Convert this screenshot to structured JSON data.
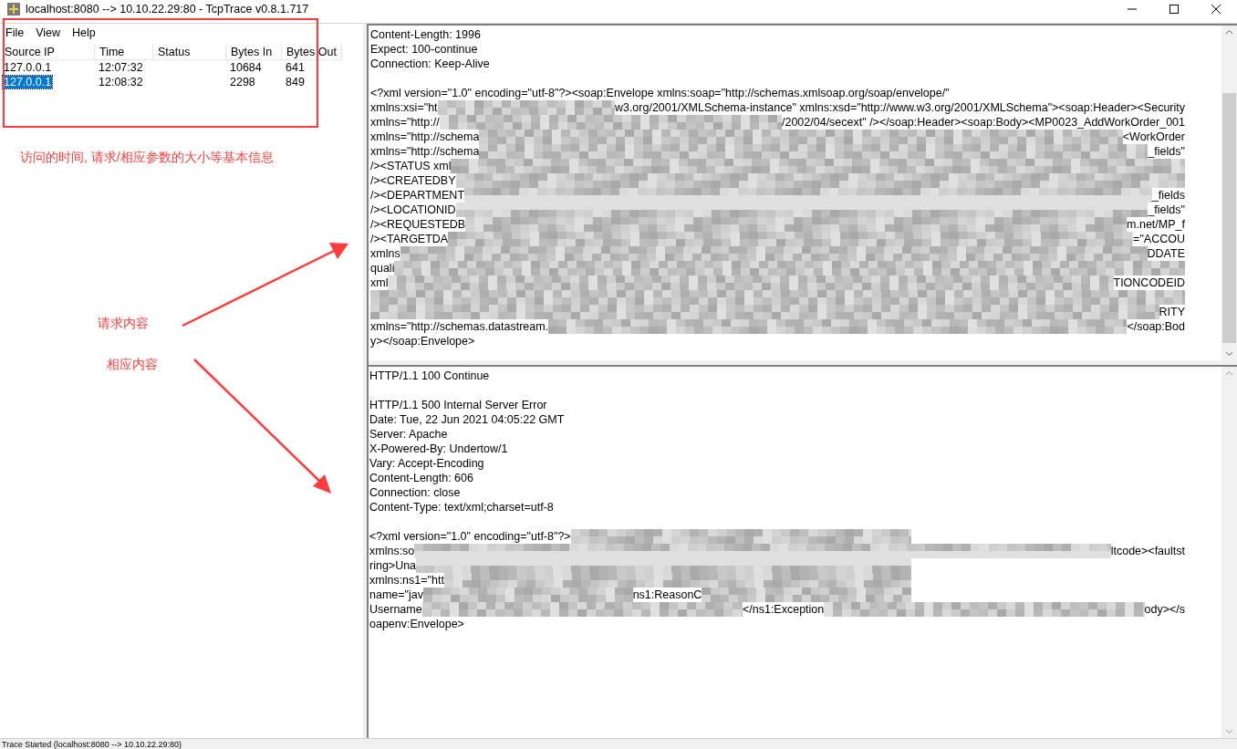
{
  "window": {
    "title": "localhost:8080 --> 10.10.22.29:80 - TcpTrace v0.8.1.717"
  },
  "menu": [
    {
      "label": "File"
    },
    {
      "label": "View"
    },
    {
      "label": "Help"
    }
  ],
  "table": {
    "columns": [
      "Source IP",
      "Time",
      "Status",
      "Bytes In",
      "Bytes Out"
    ],
    "rows": [
      {
        "cells": [
          "127.0.0.1",
          "12:07:32",
          "",
          "10684",
          "641"
        ],
        "selected": false
      },
      {
        "cells": [
          "127.0.0.1",
          "12:08:32",
          "",
          "2298",
          "849"
        ],
        "selected": true
      }
    ]
  },
  "request_pane": {
    "lines": [
      {
        "kind": "text",
        "text": "Content-Length: 1996"
      },
      {
        "kind": "text",
        "text": "Expect: 100-continue"
      },
      {
        "kind": "text",
        "text": "Connection: Keep-Alive"
      },
      {
        "kind": "blank"
      },
      {
        "kind": "text",
        "text": "<?xml version=\"1.0\" encoding=\"utf-8\"?><soap:Envelope xmlns:soap=\"http://schemas.xmlsoap.org/soap/envelope/\""
      },
      {
        "kind": "redacted",
        "parts": [
          {
            "kind": "text",
            "text": "xmlns:xsi=\"ht"
          },
          {
            "kind": "mosaic"
          },
          {
            "kind": "text",
            "text": "w3.org/2001/XMLSchema-instance\" xmlns:xsd=\"http://www.w3.org/2001/XMLSchema\"><soap:Header><Security"
          }
        ]
      },
      {
        "kind": "redacted",
        "parts": [
          {
            "kind": "text",
            "text": "xmlns=\"http://"
          },
          {
            "kind": "mosaic"
          },
          {
            "kind": "text",
            "text": "/2002/04/secext\" /></soap:Header><soap:Body><MP0023_AddWorkOrder_001"
          }
        ]
      },
      {
        "kind": "redacted",
        "parts": [
          {
            "kind": "text",
            "text": "xmlns=\"http://schema"
          },
          {
            "kind": "mosaic"
          },
          {
            "kind": "text",
            "text": "<WorkOrder"
          }
        ]
      },
      {
        "kind": "redacted",
        "parts": [
          {
            "kind": "text",
            "text": "xmlns=\"http://schema"
          },
          {
            "kind": "mosaic"
          },
          {
            "kind": "text",
            "text": "_fields\""
          }
        ]
      },
      {
        "kind": "redacted",
        "parts": [
          {
            "kind": "text",
            "text": "/><STATUS xml"
          },
          {
            "kind": "mosaic"
          }
        ]
      },
      {
        "kind": "redacted",
        "parts": [
          {
            "kind": "text",
            "text": "/><CREATEDBY"
          },
          {
            "kind": "mosaic"
          }
        ]
      },
      {
        "kind": "redacted",
        "parts": [
          {
            "kind": "text",
            "text": "/><DEPARTMENT"
          },
          {
            "kind": "mosaic"
          },
          {
            "kind": "text",
            "text": "_fields"
          }
        ]
      },
      {
        "kind": "redacted",
        "parts": [
          {
            "kind": "text",
            "text": "/><LOCATIONID"
          },
          {
            "kind": "mosaic"
          },
          {
            "kind": "text",
            "text": "_fields\""
          }
        ]
      },
      {
        "kind": "redacted",
        "parts": [
          {
            "kind": "text",
            "text": "/><REQUESTEDB"
          },
          {
            "kind": "mosaic"
          },
          {
            "kind": "text",
            "text": "m.net/MP_f"
          }
        ]
      },
      {
        "kind": "redacted",
        "parts": [
          {
            "kind": "text",
            "text": "/><TARGETDA"
          },
          {
            "kind": "mosaic"
          },
          {
            "kind": "text",
            "text": "=\"ACCOU"
          }
        ]
      },
      {
        "kind": "redacted",
        "parts": [
          {
            "kind": "text",
            "text": "xmlns"
          },
          {
            "kind": "mosaic"
          },
          {
            "kind": "text",
            "text": "DDATE"
          }
        ]
      },
      {
        "kind": "redacted",
        "parts": [
          {
            "kind": "text",
            "text": "quali"
          },
          {
            "kind": "mosaic"
          }
        ]
      },
      {
        "kind": "redacted",
        "parts": [
          {
            "kind": "text",
            "text": "xml"
          },
          {
            "kind": "mosaic"
          },
          {
            "kind": "text",
            "text": "TIONCODEID"
          }
        ]
      },
      {
        "kind": "redacted",
        "parts": [
          {
            "kind": "mosaic"
          }
        ]
      },
      {
        "kind": "redacted",
        "parts": [
          {
            "kind": "mosaic"
          },
          {
            "kind": "text",
            "text": "RITY"
          }
        ]
      },
      {
        "kind": "redacted",
        "parts": [
          {
            "kind": "text",
            "text": "xmlns=\"http://schemas.datastream."
          },
          {
            "kind": "mosaic"
          },
          {
            "kind": "text",
            "text": "</soap:Bod"
          }
        ]
      },
      {
        "kind": "text",
        "text": "y></soap:Envelope>"
      }
    ]
  },
  "response_pane": {
    "lines": [
      {
        "kind": "text",
        "text": "HTTP/1.1 100 Continue"
      },
      {
        "kind": "blank"
      },
      {
        "kind": "text",
        "text": "HTTP/1.1 500 Internal Server Error"
      },
      {
        "kind": "text",
        "text": "Date: Tue, 22 Jun 2021 04:05:22 GMT"
      },
      {
        "kind": "text",
        "text": "Server: Apache"
      },
      {
        "kind": "text",
        "text": "X-Powered-By: Undertow/1"
      },
      {
        "kind": "text",
        "text": "Vary: Accept-Encoding"
      },
      {
        "kind": "text",
        "text": "Content-Length: 606"
      },
      {
        "kind": "text",
        "text": "Connection: close"
      },
      {
        "kind": "text",
        "text": "Content-Type: text/xml;charset=utf-8"
      },
      {
        "kind": "blank"
      },
      {
        "kind": "redacted",
        "parts": [
          {
            "kind": "text",
            "text": "<?xml version=\"1.0\" encoding=\"utf-8\"?>"
          },
          {
            "kind": "mosaic"
          },
          {
            "kind": "gap"
          }
        ]
      },
      {
        "kind": "redacted",
        "parts": [
          {
            "kind": "text",
            "text": "xmlns:so"
          },
          {
            "kind": "mosaic"
          },
          {
            "kind": "text",
            "text": "ltcode><faultst"
          }
        ]
      },
      {
        "kind": "redacted",
        "parts": [
          {
            "kind": "text",
            "text": "ring>Una"
          },
          {
            "kind": "mosaic"
          },
          {
            "kind": "gap"
          }
        ]
      },
      {
        "kind": "redacted",
        "parts": [
          {
            "kind": "text",
            "text": "xmlns:ns1=\"htt"
          },
          {
            "kind": "mosaic"
          },
          {
            "kind": "gap"
          }
        ]
      },
      {
        "kind": "redacted",
        "parts": [
          {
            "kind": "text",
            "text": "name=\"jav"
          },
          {
            "kind": "mosaic"
          },
          {
            "kind": "text",
            "text": "ns1:ReasonC"
          },
          {
            "kind": "mosaic"
          },
          {
            "kind": "gap"
          }
        ]
      },
      {
        "kind": "redacted",
        "parts": [
          {
            "kind": "text",
            "text": "Username"
          },
          {
            "kind": "mosaic"
          },
          {
            "kind": "text",
            "text": "</ns1:Exception"
          },
          {
            "kind": "mosaic"
          },
          {
            "kind": "text",
            "text": "ody></s"
          }
        ]
      },
      {
        "kind": "text",
        "text": "oapenv:Envelope>"
      }
    ]
  },
  "status_bar": "Trace Started (localhost:8080 --> 10.10.22.29:80)",
  "annotations": [
    "访问的时间, 请求/相应参数的大小等基本信息",
    "请求内容",
    "相应内容"
  ]
}
